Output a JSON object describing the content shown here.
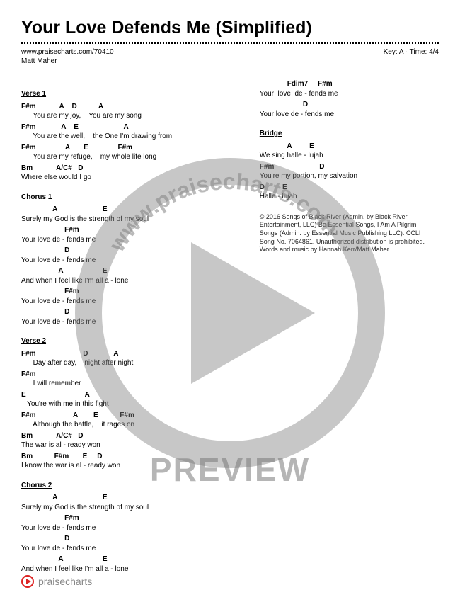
{
  "title": "Your Love Defends Me (Simplified)",
  "url": "www.praisecharts.com/70410",
  "key_time": "Key: A · Time: 4/4",
  "artist": "Matt Maher",
  "sections_left": [
    {
      "head": "Verse 1",
      "lines": [
        {
          "chords": "F#m            A    D           A",
          "lyrics": "      You are my joy,    You are my song"
        },
        {
          "chords": "F#m             A    E                       A",
          "lyrics": "      You are the well,    the One I'm drawing from"
        },
        {
          "chords": "F#m               A       E               F#m",
          "lyrics": "      You are my refuge,    my whole life long"
        },
        {
          "chords": "Bm            A/C#   D",
          "lyrics": "Where else would I go"
        }
      ]
    },
    {
      "head": "Chorus 1",
      "lines": [
        {
          "chords": "                A                       E",
          "lyrics": "Surely my God is the strength of my soul"
        },
        {
          "chords": "                      F#m",
          "lyrics": "Your love de - fends me"
        },
        {
          "chords": "                      D",
          "lyrics": "Your love de - fends me"
        },
        {
          "chords": "                   A                    E",
          "lyrics": "And when I feel like I'm all a - lone"
        },
        {
          "chords": "                      F#m",
          "lyrics": "Your love de - fends me"
        },
        {
          "chords": "                      D",
          "lyrics": "Your love de - fends me"
        }
      ]
    },
    {
      "head": "Verse 2",
      "lines": [
        {
          "chords": "F#m                        D             A",
          "lyrics": "      Day after day,    night after night"
        },
        {
          "chords": "F#m",
          "lyrics": "      I will remember"
        },
        {
          "chords": "E                              A",
          "lyrics": "   You're with me in this fight"
        },
        {
          "chords": "F#m                   A        E           F#m",
          "lyrics": "      Although the battle,    it rages on"
        },
        {
          "chords": "Bm            A/C#   D",
          "lyrics": "The war is al - ready won"
        },
        {
          "chords": "Bm           F#m       E     D",
          "lyrics": "I know the war is al - ready won"
        }
      ]
    },
    {
      "head": "Chorus 2",
      "lines": [
        {
          "chords": "                A                       E",
          "lyrics": "Surely my God is the strength of my soul"
        },
        {
          "chords": "                      F#m",
          "lyrics": "Your love de - fends me"
        },
        {
          "chords": "                      D",
          "lyrics": "Your love de - fends me"
        },
        {
          "chords": "                   A                    E",
          "lyrics": "And when I feel like I'm all a - lone"
        }
      ]
    }
  ],
  "sections_right": [
    {
      "head": null,
      "lines": [
        {
          "chords": "              Fdim7     F#m",
          "lyrics": "Your  love  de - fends me"
        },
        {
          "chords": "                      D",
          "lyrics": "Your love de - fends me"
        }
      ]
    },
    {
      "head": "Bridge",
      "lines": [
        {
          "chords": "              A         E",
          "lyrics": "We sing halle - lujah"
        },
        {
          "chords": "F#m                       D",
          "lyrics": "You're my portion, my salvation"
        },
        {
          "chords": "D         E",
          "lyrics": "Halle - lujah"
        }
      ]
    }
  ],
  "copyright": "© 2016 Songs of Black River (Admin. by Black River Entertainment, LLC) Be Essential Songs, I Am A Pilgrim Songs (Admin. by Essential Music Publishing LLC). CCLI Song No. 7064861. Unauthorized distribution is prohibited. Words and music by Hannah Kerr/Matt Maher.",
  "watermark_url": "www.praisecharts.com",
  "preview": "PREVIEW",
  "footer": "praisecharts"
}
